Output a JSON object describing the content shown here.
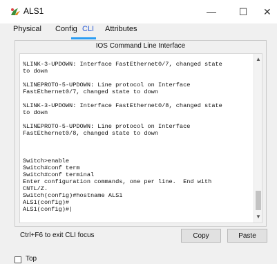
{
  "window": {
    "title": "ALS1",
    "min_glyph": "—",
    "max_glyph": "☐",
    "close_glyph": "✕"
  },
  "tabs": [
    {
      "label": "Physical"
    },
    {
      "label": "Config"
    },
    {
      "label": "CLI"
    },
    {
      "label": "Attributes"
    }
  ],
  "panel": {
    "header": "IOS Command Line Interface",
    "terminal_text": "%LINK-3-UPDOWN: Interface FastEthernet0/7, changed state\nto down\n\n%LINEPROTO-5-UPDOWN: Line protocol on Interface\nFastEthernet0/7, changed state to down\n\n%LINK-3-UPDOWN: Interface FastEthernet0/8, changed state\nto down\n\n%LINEPROTO-5-UPDOWN: Line protocol on Interface\nFastEthernet0/8, changed state to down\n\n\n\nSwitch>enable\nSwitch#conf term\nSwitch#conf terminal\nEnter configuration commands, one per line.  End with\nCNTL/Z.\nSwitch(config)#hostname ALS1\nALS1(config)#\nALS1(config)#|"
  },
  "footer": {
    "hint": "Ctrl+F6 to exit CLI focus",
    "copy_label": "Copy",
    "paste_label": "Paste",
    "top_label": "Top"
  },
  "icons": {
    "app": "packet-tracer-icon",
    "scroll_up": "chevron-up-icon",
    "scroll_down": "chevron-down-icon"
  }
}
